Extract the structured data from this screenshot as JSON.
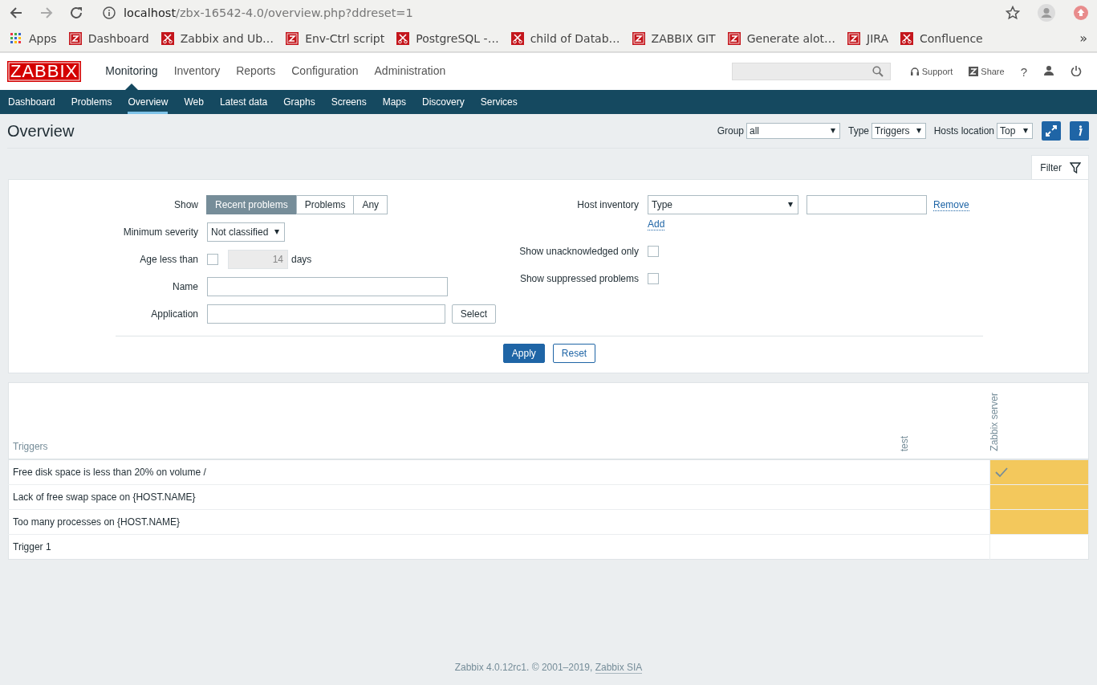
{
  "browser": {
    "url_host": "localhost",
    "url_path": "/zbx-16542-4.0/overview.php?ddreset=1",
    "more": "»",
    "bookmarks": [
      {
        "label": "Apps",
        "kind": "apps"
      },
      {
        "label": "Dashboard",
        "kind": "zabbix"
      },
      {
        "label": "Zabbix and Ub…",
        "kind": "tool"
      },
      {
        "label": "Env-Ctrl script",
        "kind": "zabbix"
      },
      {
        "label": "PostgreSQL -…",
        "kind": "tool"
      },
      {
        "label": "child of Datab…",
        "kind": "tool"
      },
      {
        "label": "ZABBIX GIT",
        "kind": "zabbix"
      },
      {
        "label": "Generate alot…",
        "kind": "zabbix"
      },
      {
        "label": "JIRA",
        "kind": "zabbix"
      },
      {
        "label": "Confluence",
        "kind": "tool"
      }
    ]
  },
  "header": {
    "logo": "ZABBIX",
    "help": "?",
    "menu": [
      {
        "label": "Monitoring",
        "selected": true
      },
      {
        "label": "Inventory",
        "selected": false
      },
      {
        "label": "Reports",
        "selected": false
      },
      {
        "label": "Configuration",
        "selected": false
      },
      {
        "label": "Administration",
        "selected": false
      }
    ],
    "links": [
      {
        "label": "Support",
        "kind": "support"
      },
      {
        "label": "Share",
        "kind": "share"
      }
    ]
  },
  "subnav": [
    {
      "label": "Dashboard",
      "selected": false
    },
    {
      "label": "Problems",
      "selected": false
    },
    {
      "label": "Overview",
      "selected": true
    },
    {
      "label": "Web",
      "selected": false
    },
    {
      "label": "Latest data",
      "selected": false
    },
    {
      "label": "Graphs",
      "selected": false
    },
    {
      "label": "Screens",
      "selected": false
    },
    {
      "label": "Maps",
      "selected": false
    },
    {
      "label": "Discovery",
      "selected": false
    },
    {
      "label": "Services",
      "selected": false
    }
  ],
  "page": {
    "title": "Overview",
    "controls": [
      {
        "label": "Group",
        "value": "all",
        "kind": "wide"
      },
      {
        "label": "Type",
        "value": "Triggers",
        "kind": "narrow"
      },
      {
        "label": "Hosts location",
        "value": "Top",
        "kind": "narrow"
      }
    ]
  },
  "filter": {
    "tab": "Filter",
    "show": {
      "label": "Show",
      "options": [
        {
          "label": "Recent problems",
          "selected": true
        },
        {
          "label": "Problems",
          "selected": false
        },
        {
          "label": "Any",
          "selected": false
        }
      ]
    },
    "min_severity": {
      "label": "Minimum severity",
      "value": "Not classified"
    },
    "age": {
      "label": "Age less than",
      "checked": false,
      "value": "14",
      "unit": "days"
    },
    "name": {
      "label": "Name"
    },
    "application": {
      "label": "Application",
      "button": "Select"
    },
    "host_inventory": {
      "label": "Host inventory",
      "field": "Type",
      "remove": "Remove",
      "add": "Add"
    },
    "unacknowledged": {
      "label": "Show unacknowledged only",
      "checked": false
    },
    "suppressed": {
      "label": "Show suppressed problems",
      "checked": false
    },
    "apply": "Apply",
    "reset": "Reset"
  },
  "table": {
    "header": "Triggers",
    "hosts": [
      "test",
      "Zabbix server"
    ],
    "rows": [
      {
        "trigger": "Free disk space is less than 20% on volume /",
        "cells": [
          {
            "problem": false,
            "acknowledged": false
          },
          {
            "problem": true,
            "acknowledged": true
          }
        ]
      },
      {
        "trigger": "Lack of free swap space on {HOST.NAME}",
        "cells": [
          {
            "problem": false,
            "acknowledged": false
          },
          {
            "problem": true,
            "acknowledged": false
          }
        ]
      },
      {
        "trigger": "Too many processes on {HOST.NAME}",
        "cells": [
          {
            "problem": false,
            "acknowledged": false
          },
          {
            "problem": true,
            "acknowledged": false
          }
        ]
      },
      {
        "trigger": "Trigger 1",
        "cells": [
          {
            "problem": false,
            "acknowledged": false
          },
          {
            "problem": false,
            "acknowledged": false
          }
        ]
      }
    ]
  },
  "footer": {
    "text": "Zabbix 4.0.12rc1. © 2001–2019, ",
    "link": "Zabbix SIA"
  }
}
